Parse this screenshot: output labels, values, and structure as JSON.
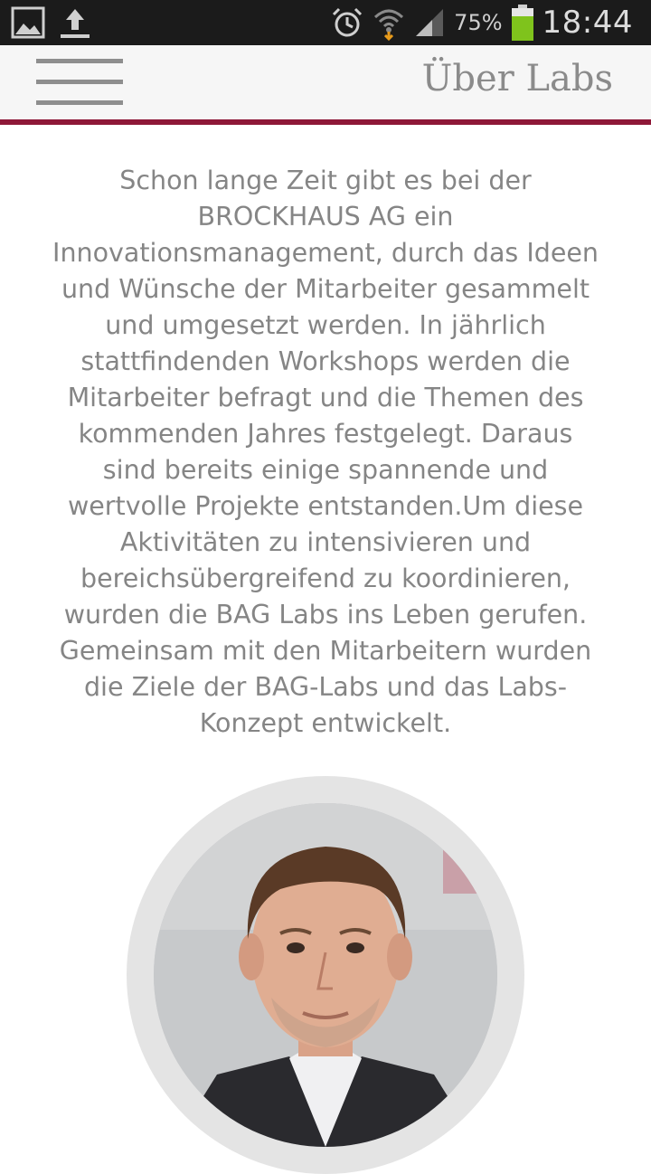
{
  "status_bar": {
    "battery_percent": "75%",
    "time": "18:44",
    "icons": [
      "image-icon",
      "upload-icon",
      "alarm-icon",
      "wifi-icon",
      "signal-icon",
      "battery-icon"
    ]
  },
  "app_bar": {
    "title": "Über Labs",
    "menu_icon": "hamburger-menu-icon"
  },
  "content": {
    "intro_text": "Schon lange Zeit gibt es bei der\nBROCKHAUS AG ein\nInnovationsmanagement, durch das Ideen\nund Wünsche der Mitarbeiter gesammelt\nund umgesetzt werden. In jährlich\nstattfindenden Workshops werden die\nMitarbeiter befragt und die Themen des\nkommenden Jahres festgelegt. Daraus\nsind bereits einige spannende und\nwertvolle Projekte entstanden.Um diese\nAktivitäten zu intensivieren und\nbereichsübergreifend zu koordinieren,\nwurden die BAG Labs ins Leben gerufen.\nGemeinsam mit den Mitarbeitern wurden\ndie Ziele der BAG-Labs und das Labs-\nKonzept entwickelt."
  },
  "colors": {
    "accent": "#8e1838",
    "text": "#858585",
    "status_bar_bg": "#1b1b1b",
    "battery_fill": "#7fc31c"
  }
}
